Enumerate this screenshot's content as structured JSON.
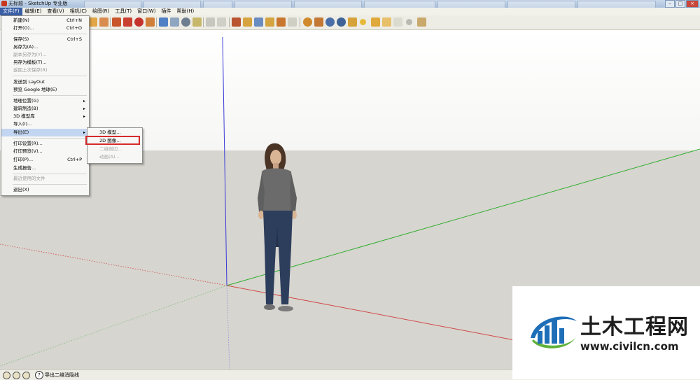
{
  "window": {
    "title": "无标题 - SketchUp 专业版"
  },
  "menubar": [
    {
      "label": "文件(F)",
      "active": true
    },
    {
      "label": "编辑(E)"
    },
    {
      "label": "查看(V)"
    },
    {
      "label": "相机(C)"
    },
    {
      "label": "绘图(R)"
    },
    {
      "label": "工具(T)"
    },
    {
      "label": "窗口(W)"
    },
    {
      "label": "插件"
    },
    {
      "label": "帮助(H)"
    }
  ],
  "file_menu": {
    "items": [
      {
        "label": "新建(N)",
        "shortcut": "Ctrl+N"
      },
      {
        "label": "打开(O)...",
        "shortcut": "Ctrl+O"
      },
      {
        "label": "保存(S)",
        "shortcut": "Ctrl+S"
      },
      {
        "label": "另存为(A)..."
      },
      {
        "label": "副本另存为(Y)...",
        "disabled": true
      },
      {
        "label": "另存为模板(T)..."
      },
      {
        "label": "返回上次保存(R)",
        "disabled": true
      },
      {
        "label": "发送到 LayOut"
      },
      {
        "label": "预览 Google 地球(E)"
      },
      {
        "label": "地理位置(G)",
        "submenu": true
      },
      {
        "label": "建筑制造(B)",
        "submenu": true
      },
      {
        "label": "3D 模型库",
        "submenu": true
      },
      {
        "label": "导入(I)..."
      },
      {
        "label": "导出(E)",
        "submenu": true,
        "hover": true
      },
      {
        "label": "打印设置(R)..."
      },
      {
        "label": "打印预览(V)..."
      },
      {
        "label": "打印(P)...",
        "shortcut": "Ctrl+P"
      },
      {
        "label": "生成报告..."
      },
      {
        "label": "最近使用的文件",
        "disabled": true
      },
      {
        "label": "退出(X)"
      }
    ],
    "submenu_arrow": "▸"
  },
  "export_submenu": {
    "items": [
      {
        "label": "3D 模型..."
      },
      {
        "label": "2D 图像...",
        "highlighted": true
      },
      {
        "label": "二维剖切...",
        "disabled": true
      },
      {
        "label": "动画(A)...",
        "disabled": true
      }
    ]
  },
  "toolbar": {
    "icons": [
      "select-icon",
      "paint-bucket-icon",
      "eraser-icon",
      "move-icon",
      "pushpull-icon",
      "rotate-icon",
      "followme-icon",
      "scale-icon",
      "offset-icon",
      "tape-measure-icon",
      "dimension-icon",
      "protractor-icon",
      "text-icon",
      "axes-icon",
      "3d-text-icon",
      "orbit-icon",
      "pan-icon",
      "zoom-icon",
      "zoom-window-icon",
      "zoom-extents-icon",
      "position-camera-icon",
      "walk-icon",
      "look-around-icon",
      "section-plane-icon",
      "component-icon",
      "3d-warehouse-icon",
      "share-model-icon",
      "extension-icon",
      "google-earth-icon",
      "get-current-view-icon",
      "toggle-terrain-icon",
      "place-model-icon",
      "get-models-icon",
      "sandbox-icon",
      "shadow-icon",
      "fog-icon",
      "match-photo-icon",
      "style-icon",
      "outliner-icon"
    ]
  },
  "status": {
    "text": "导出二维消隐线",
    "help_symbol": "?"
  },
  "watermark": {
    "title": "土木工程网",
    "url": "www.civilcn.com"
  },
  "colors": {
    "axis_blue": "#3a3ad8",
    "axis_red": "#d24a4a",
    "axis_green": "#2fae2f",
    "menu_highlight": "#c3d6f1",
    "callout_red": "#d52b2b",
    "watermark_blue": "#1f6fb8"
  }
}
